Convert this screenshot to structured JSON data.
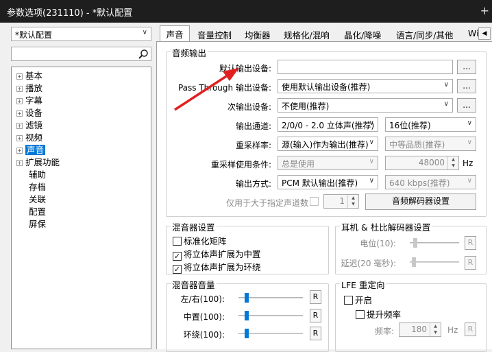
{
  "window": {
    "title": "参数选项(231110) - *默认配置",
    "plus": "+"
  },
  "profile": {
    "value": "*默认配置"
  },
  "search": {
    "placeholder": ""
  },
  "tree": [
    {
      "label": "基本",
      "expand": "+"
    },
    {
      "label": "播放",
      "expand": "+"
    },
    {
      "label": "字幕",
      "expand": "+"
    },
    {
      "label": "设备",
      "expand": "+"
    },
    {
      "label": "滤镜",
      "expand": "+"
    },
    {
      "label": "视频",
      "expand": "+"
    },
    {
      "label": "声音",
      "expand": "+"
    },
    {
      "label": "扩展功能",
      "expand": "+"
    },
    {
      "label": "辅助"
    },
    {
      "label": "存档"
    },
    {
      "label": "关联"
    },
    {
      "label": "配置"
    },
    {
      "label": "屏保"
    }
  ],
  "tabs": [
    "声音",
    "音量控制",
    "均衡器",
    "规格化/混响",
    "晶化/降噪",
    "语言/同步/其他",
    "Wi"
  ],
  "tab_scroll": "◀",
  "audio_output": {
    "title": "音频输出",
    "default_device_label": "默认输出设备:",
    "default_device_value": "",
    "passthrough_label": "Pass Through 输出设备:",
    "passthrough_value": "使用默认输出设备(推荐)",
    "secondary_label": "次输出设备:",
    "secondary_value": "不使用(推荐)",
    "channel_label": "输出通道:",
    "channel_value": "2/0/0 - 2.0 立体声(推荐)",
    "bits_value": "16位(推荐)",
    "resample_label": "重采样率:",
    "resample_value": "源(输入)作为输出(推荐)",
    "quality_value": "中等品质(推荐)",
    "resample_cond_label": "重采样使用条件:",
    "resample_cond_value": "总是使用",
    "rate_value": "48000",
    "rate_unit": "Hz",
    "output_mode_label": "输出方式:",
    "output_mode_value": "PCM 默认输出(推荐)",
    "bitrate_value": "640 kbps(推荐)",
    "only_channels_label": "仅用于大于指定声道数",
    "channels_count": "1",
    "decoder_button": "音频解码器设置",
    "browse": "..."
  },
  "mixer": {
    "title": "混音器设置",
    "normalize": {
      "label": "标准化矩阵",
      "checked": false
    },
    "center": {
      "label": "将立体声扩展为中置",
      "checked": true
    },
    "surround": {
      "label": "将立体声扩展为环绕",
      "checked": true
    }
  },
  "headphone": {
    "title": "耳机 & 杜比解码器设置",
    "level_label": "电位(10):",
    "delay_label": "延迟(20 毫秒):",
    "level_fill": 0.08,
    "delay_fill": 0.05
  },
  "mixer_volume": {
    "title": "混音器音量",
    "rows": [
      {
        "label": "左/右(100):",
        "fill": 0.1
      },
      {
        "label": "中置(100):",
        "fill": 0.1
      },
      {
        "label": "环绕(100):",
        "fill": 0.1
      }
    ]
  },
  "lfe": {
    "title": "LFE 重定向",
    "enable": {
      "label": "开启",
      "checked": false
    },
    "boost": {
      "label": "提升频率",
      "checked": false
    },
    "freq_label": "频率:",
    "freq_value": "180",
    "freq_unit": "Hz"
  },
  "reset_label": "R",
  "colors": {
    "accent": "#0078d7",
    "arrow": "#e02020",
    "titlebar": "#1e1e1e"
  }
}
